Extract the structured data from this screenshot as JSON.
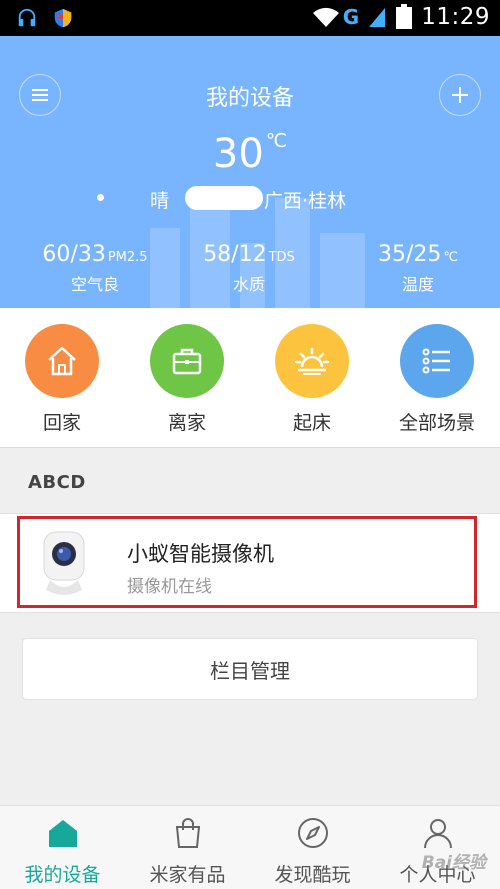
{
  "status_bar": {
    "time": "11:29",
    "network": "G",
    "icons": [
      "headset-icon",
      "shield-icon",
      "wifi-icon",
      "signal-icon",
      "battery-icon"
    ]
  },
  "header": {
    "title": "我的设备",
    "temperature": "30",
    "temperature_unit": "℃",
    "weather": "晴",
    "location": "广西·桂林",
    "stats": [
      {
        "value": "60/33",
        "unit": "PM2.5",
        "label": "空气良"
      },
      {
        "value": "58/12",
        "unit": "TDS",
        "label": "水质"
      },
      {
        "value": "35/25",
        "unit": "℃",
        "label": "温度"
      }
    ],
    "colors": {
      "background": "#79b5ff"
    }
  },
  "scenes": [
    {
      "label": "回家",
      "icon": "home-icon",
      "color": "#f98c43"
    },
    {
      "label": "离家",
      "icon": "briefcase-icon",
      "color": "#6ec546"
    },
    {
      "label": "起床",
      "icon": "sunrise-icon",
      "color": "#fcc43e"
    },
    {
      "label": "全部场景",
      "icon": "list-icon",
      "color": "#5ba6ec"
    }
  ],
  "section": {
    "title": "ABCD"
  },
  "device": {
    "name": "小蚁智能摄像机",
    "status": "摄像机在线",
    "icon": "camera-icon",
    "highlight_color": "#d2262b"
  },
  "manage_button": {
    "label": "栏目管理"
  },
  "bottom_nav": [
    {
      "label": "我的设备",
      "icon": "home-icon",
      "active": true
    },
    {
      "label": "米家有品",
      "icon": "shopping-bag-icon",
      "active": false
    },
    {
      "label": "发现酷玩",
      "icon": "compass-icon",
      "active": false
    },
    {
      "label": "个人中心",
      "icon": "user-icon",
      "active": false
    }
  ],
  "accent_color": "#17a89c",
  "watermark": "Bai经验"
}
